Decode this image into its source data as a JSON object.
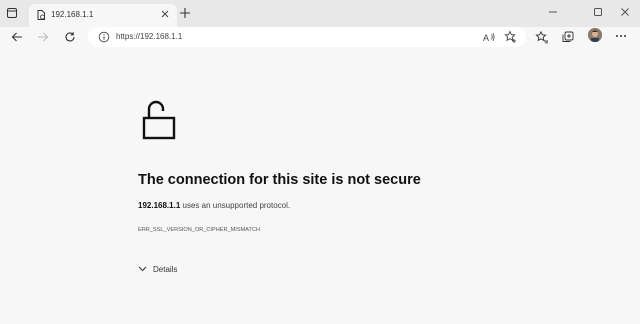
{
  "tab": {
    "title": "192.168.1.1"
  },
  "address_bar": {
    "url": "https://192.168.1.1"
  },
  "error": {
    "heading": "The connection for this site is not secure",
    "host": "192.168.1.1",
    "message": "uses an unsupported protocol.",
    "code": "ERR_SSL_VERSION_OR_CIPHER_MISMATCH",
    "details_label": "Details"
  }
}
